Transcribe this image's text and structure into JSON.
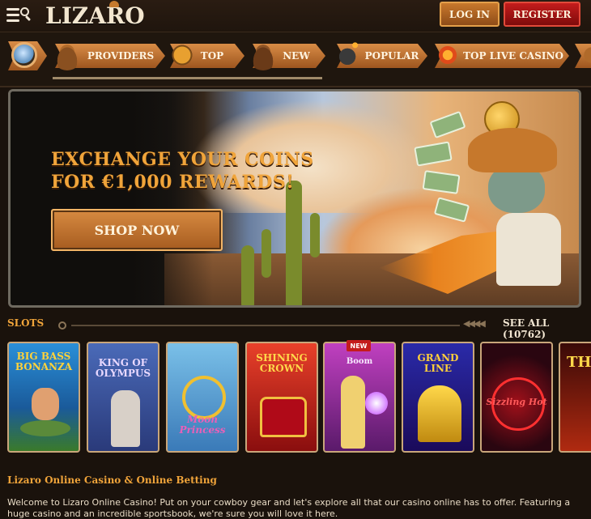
{
  "header": {
    "logo": "LIZARO",
    "login_label": "LOG IN",
    "register_label": "REGISTER",
    "menu_icon": "menu-search-icon"
  },
  "nav": {
    "items": [
      {
        "label": "",
        "icon": "search-icon"
      },
      {
        "label": "PROVIDERS",
        "icon": "cowboy-hat-icon"
      },
      {
        "label": "TOP",
        "icon": "sheriff-badge-icon"
      },
      {
        "label": "NEW",
        "icon": "cowboy-hat-icon"
      },
      {
        "label": "POPULAR",
        "icon": "bomb-icon"
      },
      {
        "label": "TOP LIVE CASINO",
        "icon": "live-badge-icon"
      }
    ]
  },
  "banner": {
    "headline_line1": "EXCHANGE YOUR COINS",
    "headline_line2": "FOR €1,000 REWARDS!",
    "cta_label": "SHOP NOW"
  },
  "slots": {
    "title": "SLOTS",
    "see_all": "SEE ALL (10762)",
    "games": [
      {
        "title": "BIG BASS BONANZA",
        "badge": "",
        "bg": "#1f7fc8"
      },
      {
        "title": "KING OF OLYMPUS",
        "badge": "",
        "bg": "#3a4c9a"
      },
      {
        "title": "Moon Princess",
        "badge": "",
        "bg": "#5aa6d8"
      },
      {
        "title": "SHINING CROWN",
        "badge": "",
        "bg": "#c4241a"
      },
      {
        "title": "Boom",
        "badge": "NEW",
        "bg": "#8a2a8a"
      },
      {
        "title": "GRAND LINE",
        "badge": "",
        "bg": "#3a2a88"
      },
      {
        "title": "Sizzling Hot",
        "badge": "",
        "bg": "#6a0a14"
      },
      {
        "title": "TH",
        "badge": "",
        "bg": "#b02a10"
      }
    ]
  },
  "about": {
    "title": "Lizaro Online Casino & Online Betting",
    "text": "Welcome to Lizaro Online Casino! Put on your cowboy gear and let's explore all that our casino online has to offer. Featuring a huge casino and an incredible sportsbook, we're sure you will love it here."
  }
}
